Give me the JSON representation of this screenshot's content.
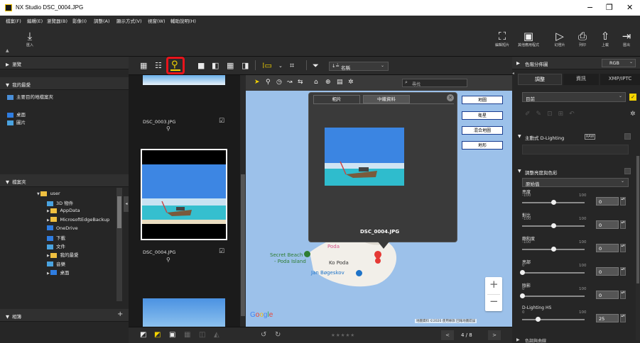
{
  "window": {
    "title": "NX Studio   DSC_0004.JPG",
    "minimize": "−",
    "maximize": "❐",
    "close": "✕"
  },
  "menu": [
    "檔案(F)",
    "編輯(E)",
    "瀏覽器(B)",
    "影像(I)",
    "調整(A)",
    "顯示方式(V)",
    "視窗(W)",
    "輔助說明(H)"
  ],
  "import_label": "匯入",
  "toolbar_right": [
    {
      "label": "編輯短片",
      "icon": "film-edit-icon",
      "glyph": "⛶"
    },
    {
      "label": "其他應用程式",
      "icon": "apps-icon",
      "glyph": "▣"
    },
    {
      "label": "幻燈片",
      "icon": "slideshow-icon",
      "glyph": "▷"
    },
    {
      "label": "列印",
      "icon": "print-icon",
      "glyph": "⎙"
    },
    {
      "label": "上載",
      "icon": "upload-icon",
      "glyph": "⇧"
    },
    {
      "label": "匯出",
      "icon": "export-icon",
      "glyph": "⇥"
    }
  ],
  "left": {
    "browse": "瀏覽",
    "favorites": "我的最愛",
    "fav_items": [
      "主要目的地檔案夾",
      "桌面",
      "圖片"
    ],
    "folders": "檔案夾",
    "tree": [
      {
        "label": "user",
        "indent": 0
      },
      {
        "label": "3D 物件",
        "indent": 1
      },
      {
        "label": "AppData",
        "indent": 1
      },
      {
        "label": "MicrosoftEdgeBackup",
        "indent": 1
      },
      {
        "label": "OneDrive",
        "indent": 1
      },
      {
        "label": "下載",
        "indent": 1
      },
      {
        "label": "文件",
        "indent": 1
      },
      {
        "label": "我的最愛",
        "indent": 1
      },
      {
        "label": "音樂",
        "indent": 1
      },
      {
        "label": "桌面",
        "indent": 1
      }
    ],
    "albums": "相簿",
    "add": "+"
  },
  "viewbar": {
    "sort_label": "名稱",
    "sort_prefix": "↓≟"
  },
  "thumbs": [
    {
      "name": "DSC_0003.JPG"
    },
    {
      "name": "DSC_0004.JPG"
    }
  ],
  "map": {
    "search_placeholder": "尋找",
    "type_buttons": [
      "地圖",
      "衛星",
      "混合地圖",
      "地形"
    ],
    "popup_tabs": [
      "相片",
      "中繼資料"
    ],
    "popup_filename": "DSC_0004.JPG",
    "labels": {
      "poda": "Poda",
      "secret_beach": "Secret Beach",
      "poda_island": "- Poda Island",
      "ko_poda": "Ko Poda",
      "jan": "Jan Bøgeskov"
    },
    "google": "Google",
    "attribution": "地圖資料 ©2020  使用條款  回報地圖錯誤",
    "zoom_in": "+",
    "zoom_out": "−"
  },
  "bottom": {
    "stars": "★★★★★",
    "page": "4 / 8",
    "prev": "<",
    "next": ">"
  },
  "right": {
    "histogram": "色階分佈圖",
    "histogram_mode": "RGB",
    "tabs": [
      "調整",
      "資訊",
      "XMP/IPTC"
    ],
    "preset": "目前",
    "adl": "主動式 D-Lighting",
    "adl_badge": "RAW",
    "brightness_section": "調整亮度與色彩",
    "mode": "原始值",
    "sliders": [
      {
        "label": "亮度",
        "min": "-100",
        "max": "100",
        "value": "0",
        "level": 0.5
      },
      {
        "label": "對比",
        "min": "-100",
        "max": "100",
        "value": "0",
        "level": 0.5
      },
      {
        "label": "飽和度",
        "min": "-100",
        "max": "100",
        "value": "0",
        "level": 0.5
      },
      {
        "label": "亮部",
        "min": "0",
        "max": "100",
        "value": "0",
        "level": 0.0
      },
      {
        "label": "陰影",
        "min": "0",
        "max": "100",
        "value": "0",
        "level": 0.0
      },
      {
        "label": "D-Lighting HS",
        "min": "0",
        "max": "100",
        "value": "25",
        "level": 0.25
      }
    ],
    "next_section": "色調與曲線"
  },
  "colors": {
    "highlight_red": "#e8141b",
    "accent_yellow": "#f5d400",
    "map_water": "#9cc1ea",
    "map_land": "#f2efe9"
  }
}
